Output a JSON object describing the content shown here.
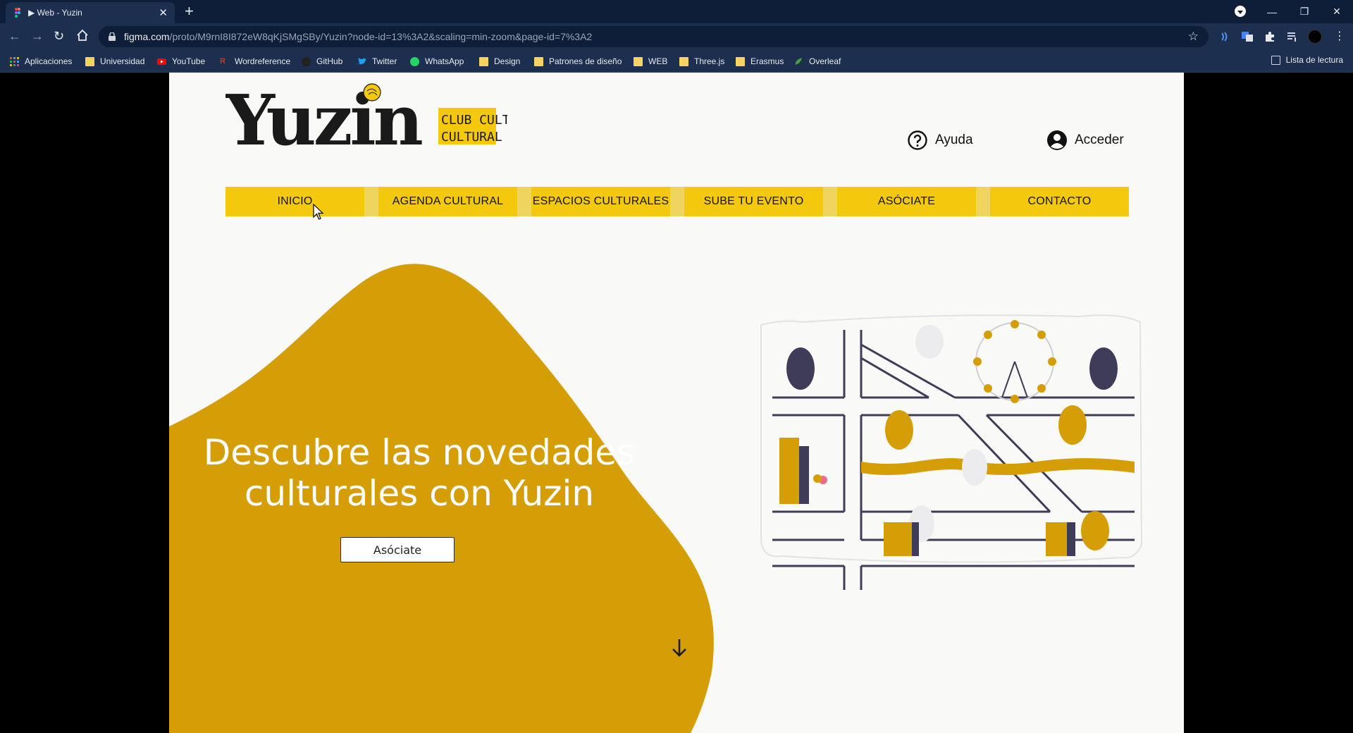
{
  "browser": {
    "tab_title": "▶ Web - Yuzin",
    "url_host": "figma.com",
    "url_path": "/proto/M9rnI8I872eW8qKjSMgSBy/Yuzin?node-id=13%3A2&scaling=min-zoom&page-id=7%3A2",
    "bookmarks": [
      {
        "label": "Aplicaciones",
        "icon": "apps-grid-icon"
      },
      {
        "label": "Universidad",
        "icon": "folder-icon"
      },
      {
        "label": "YouTube",
        "icon": "youtube-icon"
      },
      {
        "label": "Wordreference",
        "icon": "wordreference-icon"
      },
      {
        "label": "GitHub",
        "icon": "github-icon"
      },
      {
        "label": "Twitter",
        "icon": "twitter-icon"
      },
      {
        "label": "WhatsApp",
        "icon": "whatsapp-icon"
      },
      {
        "label": "Design",
        "icon": "folder-icon"
      },
      {
        "label": "Patrones de diseño",
        "icon": "folder-icon"
      },
      {
        "label": "WEB",
        "icon": "folder-icon"
      },
      {
        "label": "Three.js",
        "icon": "folder-icon"
      },
      {
        "label": "Erasmus",
        "icon": "folder-icon"
      },
      {
        "label": "Overleaf",
        "icon": "overleaf-icon"
      }
    ],
    "reading_list": "Lista de lectura"
  },
  "site": {
    "logo_text": "Yuzin",
    "logo_tag": "CLUB CULTURAL",
    "help_label": "Ayuda",
    "login_label": "Acceder",
    "nav": [
      "INICIO",
      "AGENDA CULTURAL",
      "ESPACIOS CULTURALES",
      "SUBE TU EVENTO",
      "ASÓCIATE",
      "CONTACTO"
    ],
    "hero_line1": "Descubre las novedades",
    "hero_line2": "culturales con Yuzin",
    "hero_button": "Asóciate"
  },
  "colors": {
    "accent_yellow": "#f4c90d",
    "blob_gold": "#d69e06",
    "page_bg": "#f9f9f8",
    "chrome_dark": "#0e1e38"
  }
}
